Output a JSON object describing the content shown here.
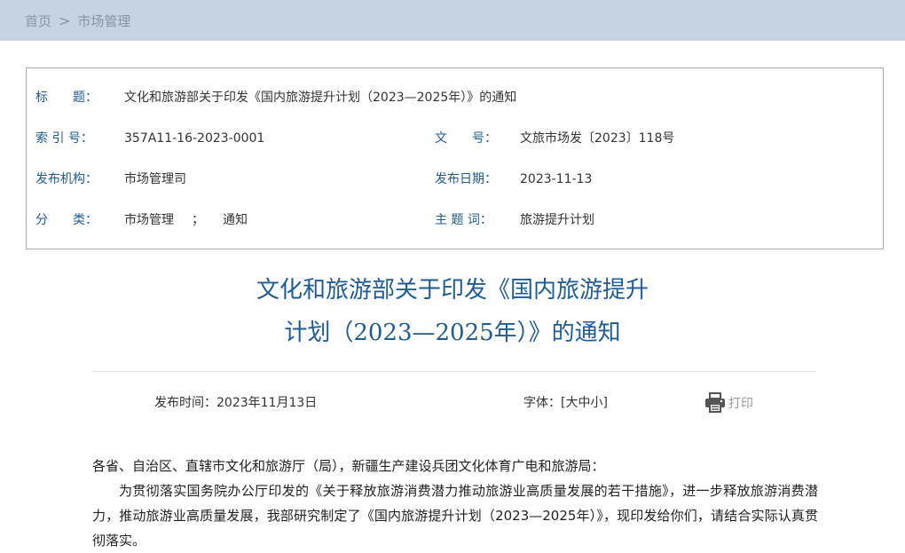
{
  "breadcrumb": {
    "home": "首页",
    "separator": ">",
    "current": "市场管理"
  },
  "meta": {
    "title_label": "标　　题：",
    "title_value": "文化和旅游部关于印发《国内旅游提升计划（2023—2025年）》的通知",
    "index_label": "索 引 号：",
    "index_value": "357A11-16-2023-0001",
    "docno_label": "文　　号：",
    "docno_value": "文旅市场发〔2023〕118号",
    "org_label": "发布机构：",
    "org_value": "市场管理司",
    "date_label": "发布日期：",
    "date_value": "2023-11-13",
    "category_label": "分　　类：",
    "category_value_1": "市场管理",
    "category_sep": "；",
    "category_value_2": "通知",
    "keyword_label": "主 题 词：",
    "keyword_value": "旅游提升计划"
  },
  "article": {
    "title_line1": "文化和旅游部关于印发《国内旅游提升",
    "title_line2": "计划（2023—2025年）》的通知",
    "publish_time": "发布时间：2023年11月13日",
    "font_size_label": "字体：",
    "font_size_open": "[",
    "font_large": "大",
    "font_medium": "中",
    "font_small": "小",
    "font_size_close": "]",
    "print_label": "打印",
    "salutation": "各省、自治区、直辖市文化和旅游厅（局），新疆生产建设兵团文化体育广电和旅游局：",
    "paragraph_1": "为贯彻落实国务院办公厅印发的《关于释放旅游消费潜力推动旅游业高质量发展的若干措施》，进一步释放旅游消费潜力，推动旅游业高质量发展，我部研究制定了《国内旅游提升计划（2023—2025年）》，现印发给你们，请结合实际认真贯彻落实。"
  },
  "colors": {
    "breadcrumb_bg": "#c5d3e3",
    "label_blue": "#1f5c94",
    "title_blue": "#1f5c94"
  }
}
